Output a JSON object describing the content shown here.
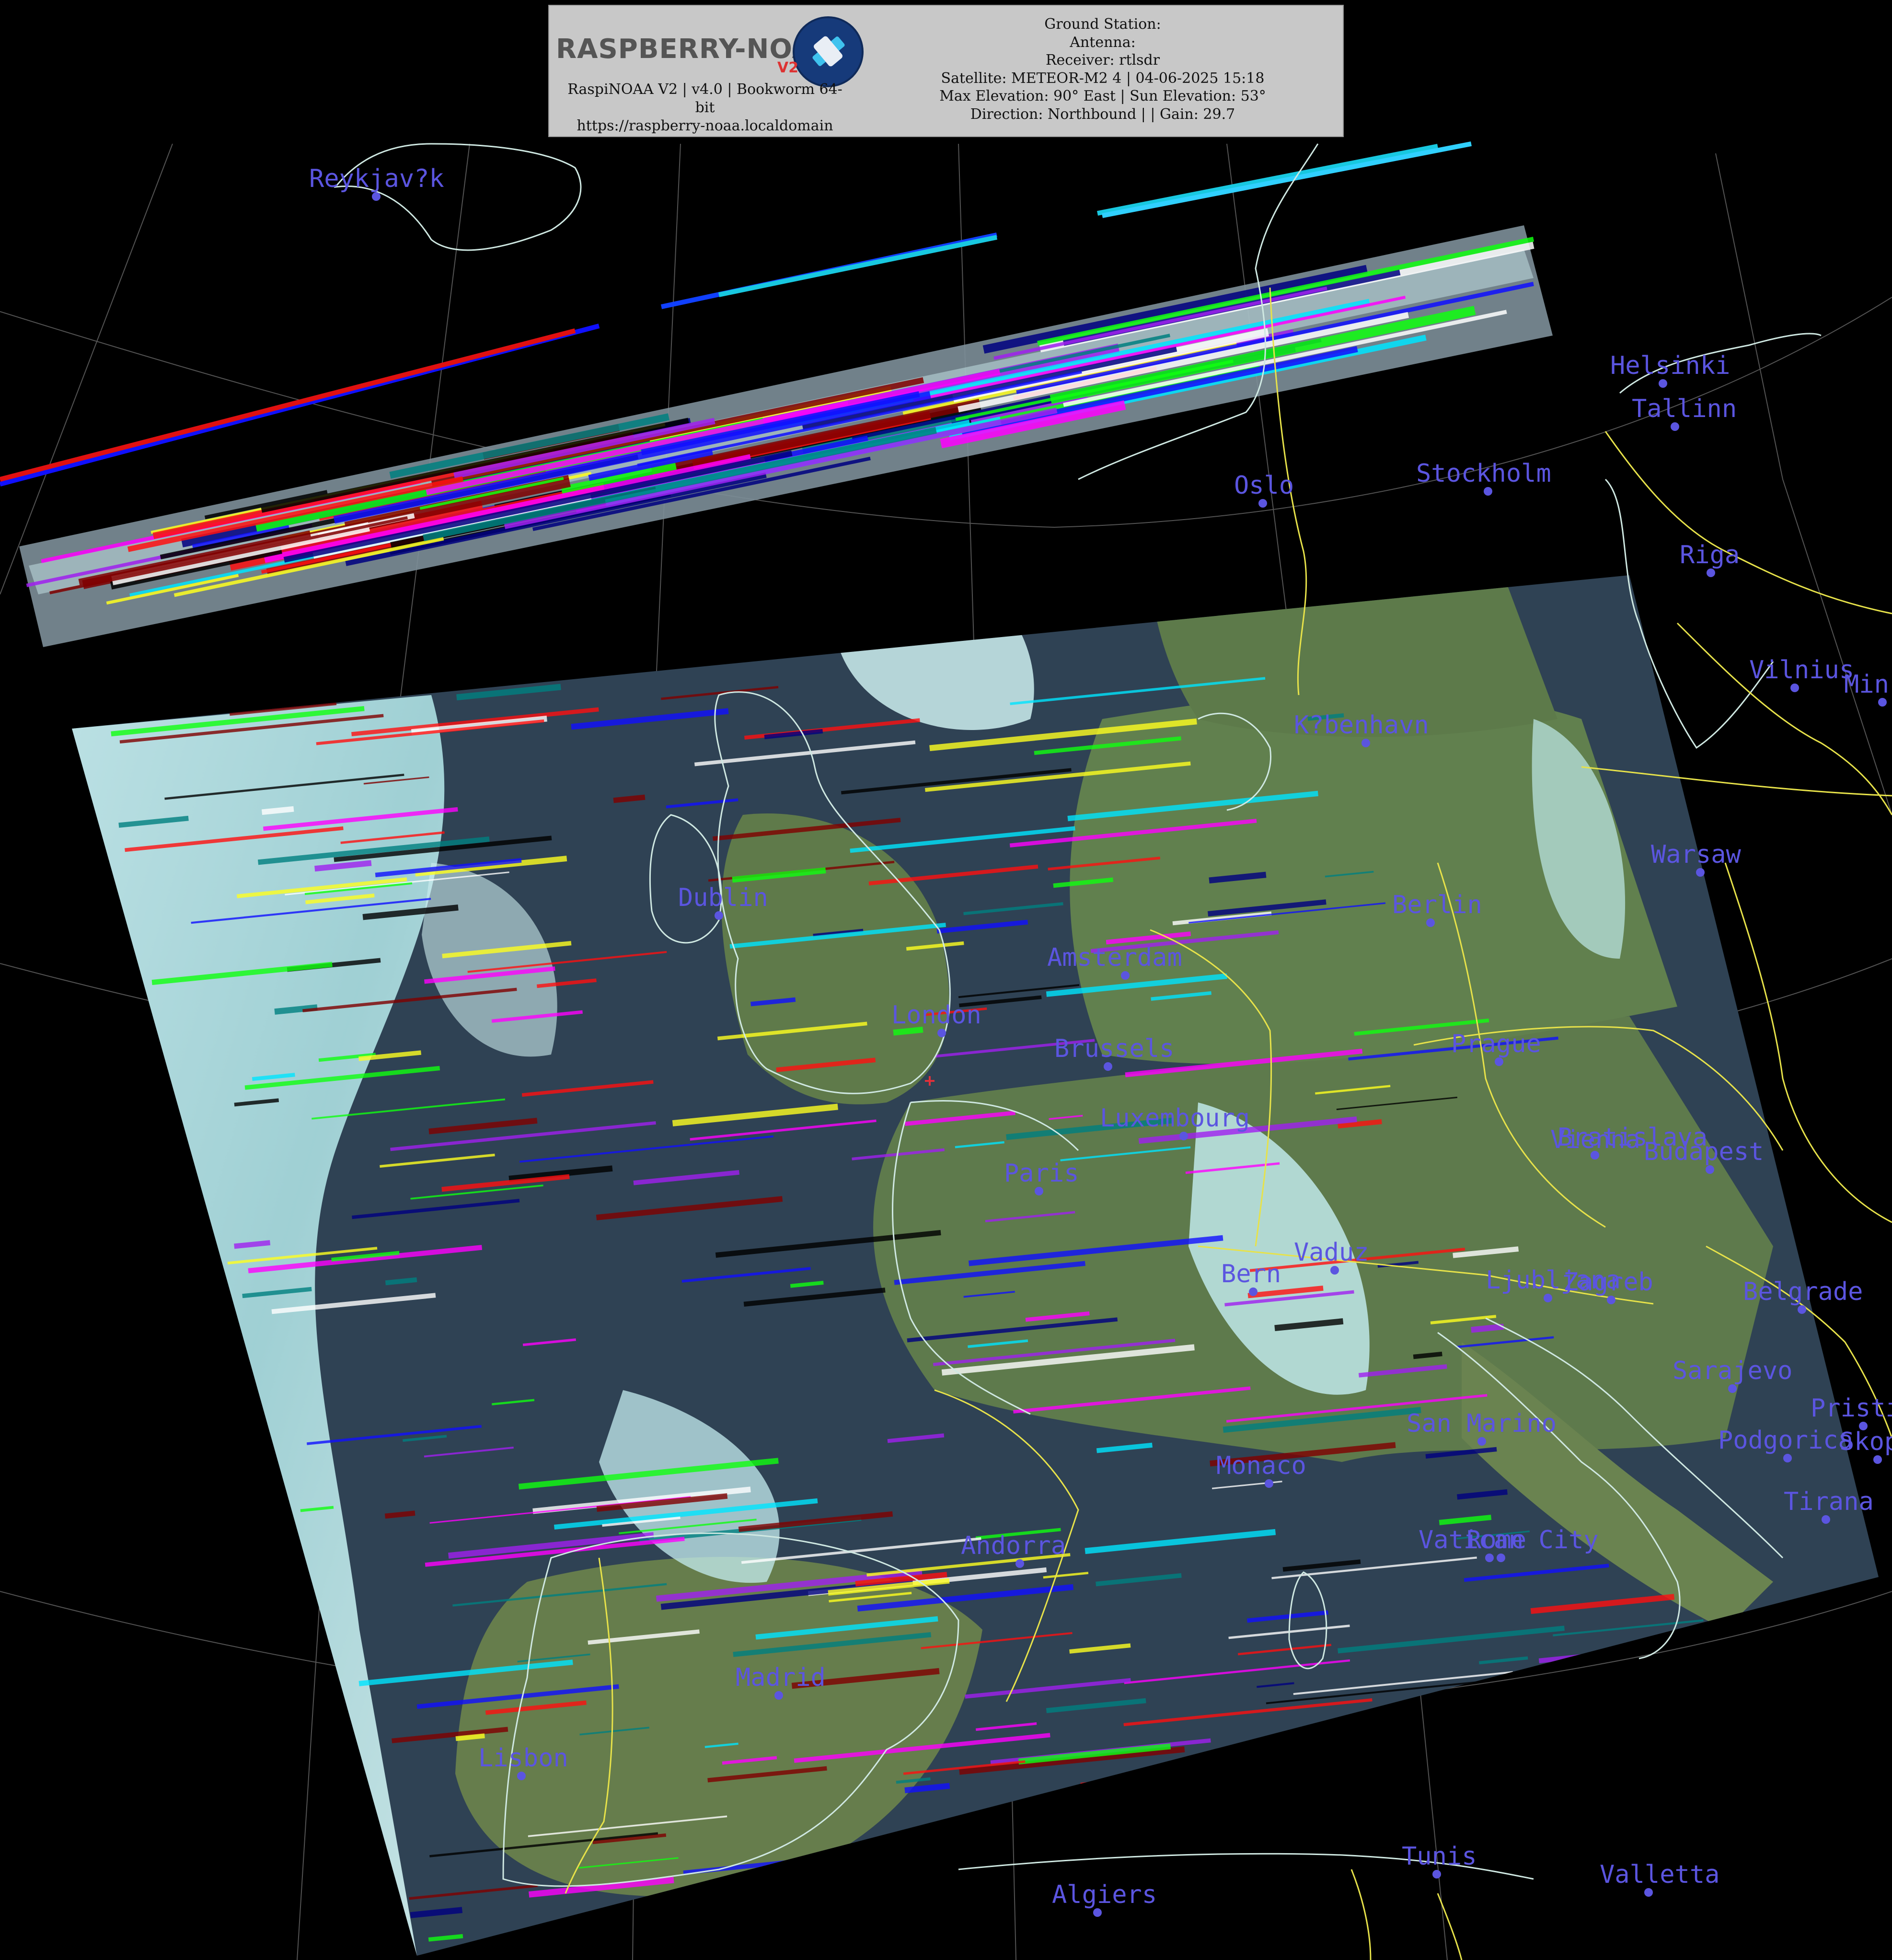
{
  "header": {
    "logo_text": "RASPBERRY-NOAA",
    "logo_badge": "V2",
    "app_line": "RaspiNOAA V2 | v4.0 | Bookworm 64-",
    "app_line_cont": "bit",
    "url": "https://raspberry-noaa.localdomain",
    "ground_station": "Ground Station:",
    "antenna": "Antenna:",
    "receiver": "Receiver: rtlsdr",
    "satellite": "Satellite: METEOR-M2 4 | 04-06-2025 15:18",
    "elevation": "Max Elevation: 90° East | Sun Elevation: 53°",
    "direction": "Direction: Northbound | | Gain: 29.7"
  },
  "cities": [
    {
      "name": "Reykjav?k"
    },
    {
      "name": "Helsinki"
    },
    {
      "name": "Tallinn"
    },
    {
      "name": "Oslo"
    },
    {
      "name": "Stockholm"
    },
    {
      "name": "Riga"
    },
    {
      "name": "Vilnius"
    },
    {
      "name": "Min"
    },
    {
      "name": "K?benhavn"
    },
    {
      "name": "Warsaw"
    },
    {
      "name": "Dublin"
    },
    {
      "name": "Berlin"
    },
    {
      "name": "Amsterdam"
    },
    {
      "name": "London"
    },
    {
      "name": "Brussels"
    },
    {
      "name": "Prague"
    },
    {
      "name": "Luxembourg"
    },
    {
      "name": "Bratislava"
    },
    {
      "name": "Vienna"
    },
    {
      "name": "Budapest"
    },
    {
      "name": "Paris"
    },
    {
      "name": "Vaduz"
    },
    {
      "name": "Bern"
    },
    {
      "name": "Ljubljana"
    },
    {
      "name": "Zagreb"
    },
    {
      "name": "Belgrade"
    },
    {
      "name": "Sarajevo"
    },
    {
      "name": "Pristina"
    },
    {
      "name": "San Marino"
    },
    {
      "name": "Podgorica"
    },
    {
      "name": "Skopje"
    },
    {
      "name": "Monaco"
    },
    {
      "name": "Tirana"
    },
    {
      "name": "Andorra"
    },
    {
      "name": "Vatican City"
    },
    {
      "name": "Rome"
    },
    {
      "name": "Madrid"
    },
    {
      "name": "Lisbon"
    },
    {
      "name": "Tunis"
    },
    {
      "name": "Valletta"
    },
    {
      "name": "Algiers"
    }
  ],
  "colors": {
    "label": "#5b55e0",
    "coast": "#cfe8e2",
    "border": "#e7e24a",
    "grid": "#8a8a8a",
    "cloud": "#bfe9ea",
    "sea": "#27394e",
    "land": "#5f7a4a"
  }
}
